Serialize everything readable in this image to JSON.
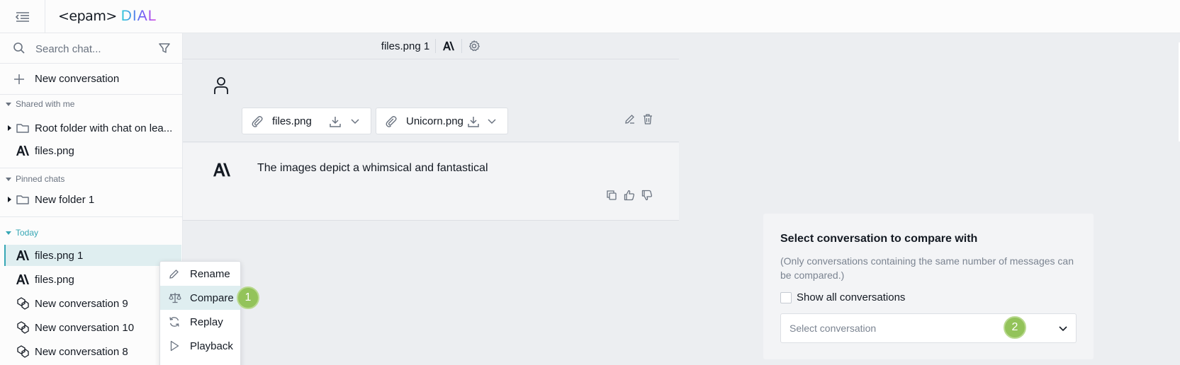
{
  "header": {
    "logo_epam": "<epam>",
    "logo_dial": "DIAL",
    "menu_icon": "menu-collapse-icon"
  },
  "sidebar": {
    "search_placeholder": "Search chat...",
    "new_conversation": "New conversation",
    "sections": {
      "shared": {
        "title": "Shared with me",
        "items": [
          {
            "label": "Root folder with chat on lea...",
            "icon": "folder-icon"
          },
          {
            "label": "files.png",
            "icon": "anthropic-icon"
          }
        ]
      },
      "pinned": {
        "title": "Pinned chats",
        "items": [
          {
            "label": "New folder 1",
            "icon": "folder-icon"
          }
        ]
      },
      "today": {
        "title": "Today",
        "items": [
          {
            "label": "files.png 1",
            "icon": "anthropic-icon",
            "selected": true
          },
          {
            "label": "files.png",
            "icon": "anthropic-icon"
          },
          {
            "label": "New conversation 9",
            "icon": "model-icon"
          },
          {
            "label": "New conversation 10",
            "icon": "model-icon"
          },
          {
            "label": "New conversation 8",
            "icon": "model-icon"
          }
        ]
      }
    }
  },
  "context_menu": {
    "items": [
      {
        "label": "Rename",
        "icon": "pencil-icon"
      },
      {
        "label": "Compare",
        "icon": "scales-icon"
      },
      {
        "label": "Replay",
        "icon": "replay-icon"
      },
      {
        "label": "Playback",
        "icon": "play-icon"
      }
    ]
  },
  "chat": {
    "title": "files.png 1",
    "attachments": [
      {
        "name": "files.png"
      },
      {
        "name": "Unicorn.png"
      }
    ],
    "assistant_message": "The images depict a whimsical and fantastical"
  },
  "compare": {
    "title": "Select conversation to compare with",
    "note": "(Only conversations containing the same number of messages can be compared.)",
    "show_all_label": "Show all conversations",
    "select_placeholder": "Select conversation"
  },
  "badges": {
    "one": "1",
    "two": "2"
  },
  "colors": {
    "accent": "#37a7b5",
    "badge": "#93c35a",
    "selected_bg": "#dfeef0"
  }
}
